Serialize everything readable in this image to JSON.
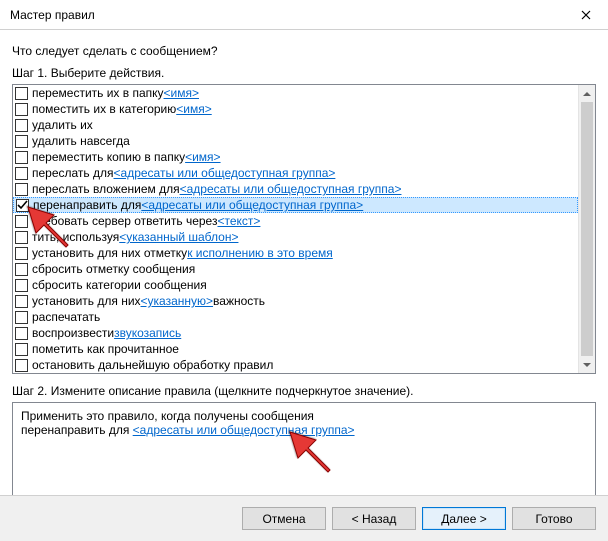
{
  "window": {
    "title": "Мастер правил"
  },
  "question": "Что следует сделать с сообщением?",
  "step1_label": "Шаг 1. Выберите действия.",
  "actions": [
    {
      "pre": "переместить их в папку ",
      "link": "<имя>",
      "post": "",
      "checked": false
    },
    {
      "pre": "поместить их в категорию ",
      "link": "<имя>",
      "post": "",
      "checked": false
    },
    {
      "pre": "удалить их",
      "link": "",
      "post": "",
      "checked": false
    },
    {
      "pre": "удалить навсегда",
      "link": "",
      "post": "",
      "checked": false
    },
    {
      "pre": "переместить копию в папку ",
      "link": "<имя>",
      "post": "",
      "checked": false
    },
    {
      "pre": "переслать для ",
      "link": "<адресаты или общедоступная группа>",
      "post": "",
      "checked": false
    },
    {
      "pre": "переслать вложением для ",
      "link": "<адресаты или общедоступная группа>",
      "post": "",
      "checked": false
    },
    {
      "pre": "перенаправить для ",
      "link": "<адресаты или общедоступная группа>",
      "post": "",
      "checked": true
    },
    {
      "pre": "требовать сервер ответить через ",
      "link": "<текст>",
      "post": "",
      "checked": false
    },
    {
      "pre": "тить, используя ",
      "link": "<указанный шаблон>",
      "post": "",
      "checked": false
    },
    {
      "pre": "установить для них отметку ",
      "link": "к исполнению в это время",
      "post": "",
      "checked": false
    },
    {
      "pre": "сбросить отметку сообщения",
      "link": "",
      "post": "",
      "checked": false
    },
    {
      "pre": "сбросить категории сообщения",
      "link": "",
      "post": "",
      "checked": false
    },
    {
      "pre": "установить для них ",
      "link": "<указанную>",
      "post": " важность",
      "checked": false
    },
    {
      "pre": "распечатать",
      "link": "",
      "post": "",
      "checked": false
    },
    {
      "pre": "воспроизвести ",
      "link": "звукозапись",
      "post": "",
      "checked": false
    },
    {
      "pre": "пометить как прочитанное",
      "link": "",
      "post": "",
      "checked": false
    },
    {
      "pre": "остановить дальнейшую обработку правил",
      "link": "",
      "post": "",
      "checked": false
    }
  ],
  "step2_label": "Шаг 2. Измените описание правила (щелкните подчеркнутое значение).",
  "desc": {
    "line1": "Применить это правило, когда получены сообщения",
    "line2_pre": "перенаправить для ",
    "line2_link": "<адресаты или общедоступная группа>"
  },
  "buttons": {
    "cancel": "Отмена",
    "back": "< Назад",
    "next": "Далее >",
    "finish": "Готово"
  }
}
